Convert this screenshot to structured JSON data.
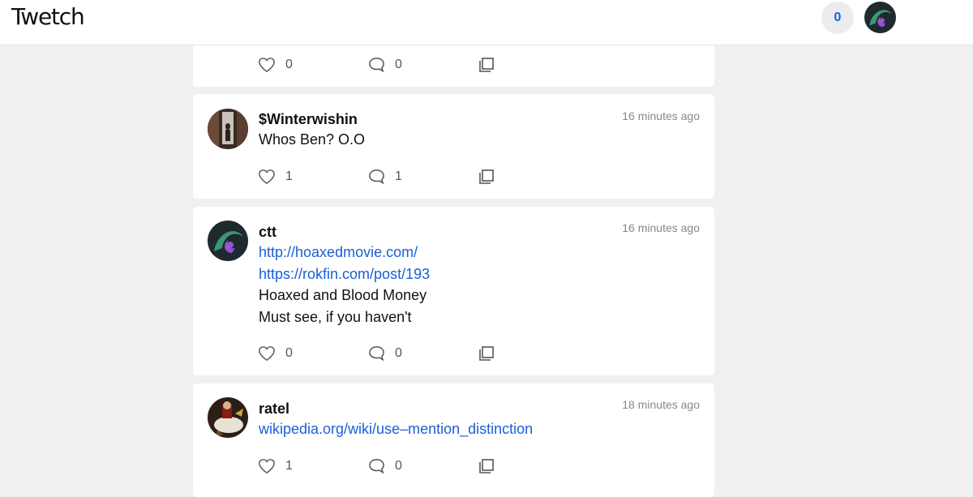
{
  "app": {
    "logo": "Twetch"
  },
  "header": {
    "notification_count": "0"
  },
  "posts": [
    {
      "name": "",
      "time": "",
      "lines": [],
      "likes": "0",
      "replies": "0"
    },
    {
      "name": "$Winterwishin",
      "time": "16 minutes ago",
      "lines": [
        {
          "text": "Whos Ben? O.O",
          "link": false
        }
      ],
      "likes": "1",
      "replies": "1"
    },
    {
      "name": "ctt",
      "time": "16 minutes ago",
      "lines": [
        {
          "text": "http://hoaxedmovie.com/",
          "link": true
        },
        {
          "text": "https://rokfin.com/post/193",
          "link": true
        },
        {
          "text": "Hoaxed and Blood Money",
          "link": false
        },
        {
          "text": "Must see, if you haven't",
          "link": false
        }
      ],
      "likes": "0",
      "replies": "0"
    },
    {
      "name": "ratel",
      "time": "18 minutes ago",
      "lines": [
        {
          "text": "wikipedia.org/wiki/use–mention_distinction",
          "link": true
        }
      ],
      "likes": "1",
      "replies": "0"
    }
  ],
  "icons": {
    "like": "heart-icon",
    "reply": "comment-icon",
    "copy": "copy-icon"
  },
  "colors": {
    "link": "#1a5fd6",
    "background": "#f0f0f2"
  }
}
